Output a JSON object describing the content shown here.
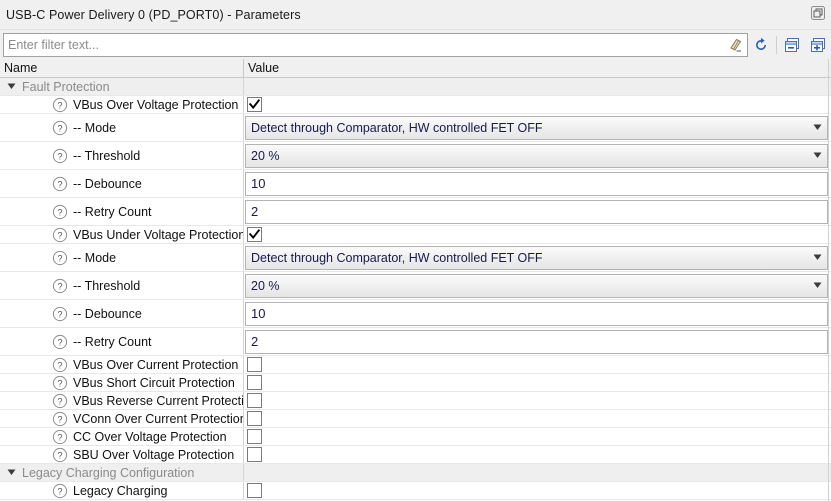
{
  "window": {
    "title": "USB-C Power Delivery 0 (PD_PORT0) - Parameters",
    "maximize_icon": "maximize-restore-icon"
  },
  "toolbar": {
    "filter_placeholder": "Enter filter text...",
    "filter_value": "",
    "clear_icon": "eraser-clear-icon",
    "refresh_icon": "refresh-icon",
    "collapse_all_icon": "collapse-all-icon",
    "expand_all_icon": "expand-all-icon",
    "accent_color": "#2a5db0"
  },
  "table": {
    "columns": [
      "Name",
      "Value"
    ],
    "rows": [
      {
        "kind": "group",
        "label": "Fault Protection",
        "expanded": true
      },
      {
        "kind": "checkbox",
        "label": "VBus Over Voltage Protection",
        "checked": true
      },
      {
        "kind": "combo",
        "label": "-- Mode",
        "value": "Detect through Comparator, HW controlled FET OFF"
      },
      {
        "kind": "combo",
        "label": "-- Threshold",
        "value": "20 %"
      },
      {
        "kind": "text",
        "label": "-- Debounce",
        "value": "10"
      },
      {
        "kind": "text",
        "label": "-- Retry Count",
        "value": "2"
      },
      {
        "kind": "checkbox",
        "label": "VBus Under Voltage Protection",
        "checked": true
      },
      {
        "kind": "combo",
        "label": "-- Mode",
        "value": "Detect through Comparator, HW controlled FET OFF"
      },
      {
        "kind": "combo",
        "label": "-- Threshold",
        "value": "20 %"
      },
      {
        "kind": "text",
        "label": "-- Debounce",
        "value": "10"
      },
      {
        "kind": "text",
        "label": "-- Retry Count",
        "value": "2"
      },
      {
        "kind": "checkbox",
        "label": "VBus Over Current Protection",
        "checked": false
      },
      {
        "kind": "checkbox",
        "label": "VBus Short Circuit Protection",
        "checked": false
      },
      {
        "kind": "checkbox",
        "label": "VBus Reverse Current Protection",
        "checked": false
      },
      {
        "kind": "checkbox",
        "label": "VConn Over Current Protection",
        "checked": false
      },
      {
        "kind": "checkbox",
        "label": "CC Over Voltage Protection",
        "checked": false
      },
      {
        "kind": "checkbox",
        "label": "SBU Over Voltage Protection",
        "checked": false
      },
      {
        "kind": "group",
        "label": "Legacy Charging Configuration",
        "expanded": true
      },
      {
        "kind": "checkbox",
        "label": "Legacy Charging",
        "checked": false
      }
    ]
  }
}
